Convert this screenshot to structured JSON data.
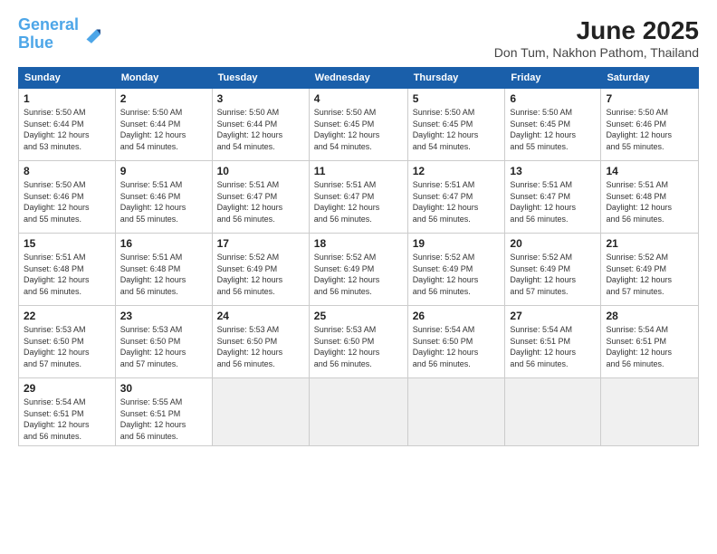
{
  "logo": {
    "line1": "General",
    "line2": "Blue"
  },
  "title": "June 2025",
  "subtitle": "Don Tum, Nakhon Pathom, Thailand",
  "days_of_week": [
    "Sunday",
    "Monday",
    "Tuesday",
    "Wednesday",
    "Thursday",
    "Friday",
    "Saturday"
  ],
  "weeks": [
    [
      {
        "day": "1",
        "info": "Sunrise: 5:50 AM\nSunset: 6:44 PM\nDaylight: 12 hours\nand 53 minutes."
      },
      {
        "day": "2",
        "info": "Sunrise: 5:50 AM\nSunset: 6:44 PM\nDaylight: 12 hours\nand 54 minutes."
      },
      {
        "day": "3",
        "info": "Sunrise: 5:50 AM\nSunset: 6:44 PM\nDaylight: 12 hours\nand 54 minutes."
      },
      {
        "day": "4",
        "info": "Sunrise: 5:50 AM\nSunset: 6:45 PM\nDaylight: 12 hours\nand 54 minutes."
      },
      {
        "day": "5",
        "info": "Sunrise: 5:50 AM\nSunset: 6:45 PM\nDaylight: 12 hours\nand 54 minutes."
      },
      {
        "day": "6",
        "info": "Sunrise: 5:50 AM\nSunset: 6:45 PM\nDaylight: 12 hours\nand 55 minutes."
      },
      {
        "day": "7",
        "info": "Sunrise: 5:50 AM\nSunset: 6:46 PM\nDaylight: 12 hours\nand 55 minutes."
      }
    ],
    [
      {
        "day": "8",
        "info": "Sunrise: 5:50 AM\nSunset: 6:46 PM\nDaylight: 12 hours\nand 55 minutes."
      },
      {
        "day": "9",
        "info": "Sunrise: 5:51 AM\nSunset: 6:46 PM\nDaylight: 12 hours\nand 55 minutes."
      },
      {
        "day": "10",
        "info": "Sunrise: 5:51 AM\nSunset: 6:47 PM\nDaylight: 12 hours\nand 56 minutes."
      },
      {
        "day": "11",
        "info": "Sunrise: 5:51 AM\nSunset: 6:47 PM\nDaylight: 12 hours\nand 56 minutes."
      },
      {
        "day": "12",
        "info": "Sunrise: 5:51 AM\nSunset: 6:47 PM\nDaylight: 12 hours\nand 56 minutes."
      },
      {
        "day": "13",
        "info": "Sunrise: 5:51 AM\nSunset: 6:47 PM\nDaylight: 12 hours\nand 56 minutes."
      },
      {
        "day": "14",
        "info": "Sunrise: 5:51 AM\nSunset: 6:48 PM\nDaylight: 12 hours\nand 56 minutes."
      }
    ],
    [
      {
        "day": "15",
        "info": "Sunrise: 5:51 AM\nSunset: 6:48 PM\nDaylight: 12 hours\nand 56 minutes."
      },
      {
        "day": "16",
        "info": "Sunrise: 5:51 AM\nSunset: 6:48 PM\nDaylight: 12 hours\nand 56 minutes."
      },
      {
        "day": "17",
        "info": "Sunrise: 5:52 AM\nSunset: 6:49 PM\nDaylight: 12 hours\nand 56 minutes."
      },
      {
        "day": "18",
        "info": "Sunrise: 5:52 AM\nSunset: 6:49 PM\nDaylight: 12 hours\nand 56 minutes."
      },
      {
        "day": "19",
        "info": "Sunrise: 5:52 AM\nSunset: 6:49 PM\nDaylight: 12 hours\nand 56 minutes."
      },
      {
        "day": "20",
        "info": "Sunrise: 5:52 AM\nSunset: 6:49 PM\nDaylight: 12 hours\nand 57 minutes."
      },
      {
        "day": "21",
        "info": "Sunrise: 5:52 AM\nSunset: 6:49 PM\nDaylight: 12 hours\nand 57 minutes."
      }
    ],
    [
      {
        "day": "22",
        "info": "Sunrise: 5:53 AM\nSunset: 6:50 PM\nDaylight: 12 hours\nand 57 minutes."
      },
      {
        "day": "23",
        "info": "Sunrise: 5:53 AM\nSunset: 6:50 PM\nDaylight: 12 hours\nand 57 minutes."
      },
      {
        "day": "24",
        "info": "Sunrise: 5:53 AM\nSunset: 6:50 PM\nDaylight: 12 hours\nand 56 minutes."
      },
      {
        "day": "25",
        "info": "Sunrise: 5:53 AM\nSunset: 6:50 PM\nDaylight: 12 hours\nand 56 minutes."
      },
      {
        "day": "26",
        "info": "Sunrise: 5:54 AM\nSunset: 6:50 PM\nDaylight: 12 hours\nand 56 minutes."
      },
      {
        "day": "27",
        "info": "Sunrise: 5:54 AM\nSunset: 6:51 PM\nDaylight: 12 hours\nand 56 minutes."
      },
      {
        "day": "28",
        "info": "Sunrise: 5:54 AM\nSunset: 6:51 PM\nDaylight: 12 hours\nand 56 minutes."
      }
    ],
    [
      {
        "day": "29",
        "info": "Sunrise: 5:54 AM\nSunset: 6:51 PM\nDaylight: 12 hours\nand 56 minutes."
      },
      {
        "day": "30",
        "info": "Sunrise: 5:55 AM\nSunset: 6:51 PM\nDaylight: 12 hours\nand 56 minutes."
      },
      {
        "day": "",
        "info": ""
      },
      {
        "day": "",
        "info": ""
      },
      {
        "day": "",
        "info": ""
      },
      {
        "day": "",
        "info": ""
      },
      {
        "day": "",
        "info": ""
      }
    ]
  ]
}
